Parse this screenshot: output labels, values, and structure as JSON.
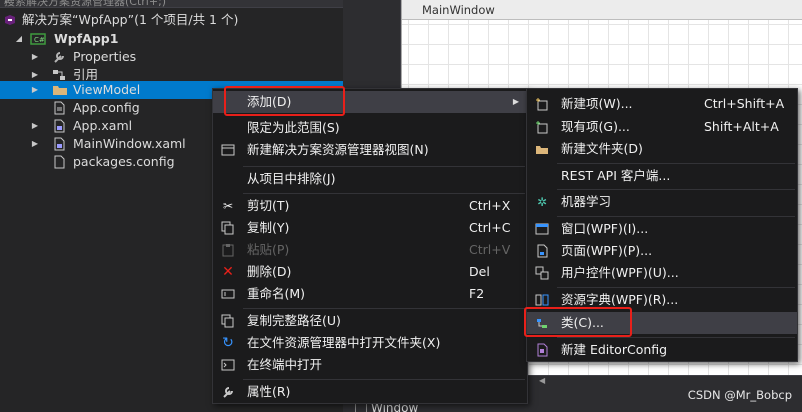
{
  "explorer": {
    "search_placeholder": "搜索解决方案资源管理器(Ctrl+;)",
    "items": [
      {
        "label": "解决方案“WpfApp”(1 个项目/共 1 个)"
      },
      {
        "label": "WpfApp1"
      },
      {
        "label": "Properties"
      },
      {
        "label": "引用"
      },
      {
        "label": "ViewModel"
      },
      {
        "label": "App.config"
      },
      {
        "label": "App.xaml"
      },
      {
        "label": "MainWindow.xaml"
      },
      {
        "label": "packages.config"
      }
    ]
  },
  "designer": {
    "window_title": "MainWindow",
    "xaml_tab": "Window",
    "watermark": "CSDN @Mr_Bobcp"
  },
  "context_menu": {
    "items": [
      {
        "label": "添加(D)",
        "shortcut": ""
      },
      {
        "label": "限定为此范围(S)",
        "shortcut": ""
      },
      {
        "label": "新建解决方案资源管理器视图(N)",
        "shortcut": ""
      },
      {
        "label": "从项目中排除(J)",
        "shortcut": ""
      },
      {
        "label": "剪切(T)",
        "shortcut": "Ctrl+X"
      },
      {
        "label": "复制(Y)",
        "shortcut": "Ctrl+C"
      },
      {
        "label": "粘贴(P)",
        "shortcut": "Ctrl+V"
      },
      {
        "label": "删除(D)",
        "shortcut": "Del"
      },
      {
        "label": "重命名(M)",
        "shortcut": "F2"
      },
      {
        "label": "复制完整路径(U)",
        "shortcut": ""
      },
      {
        "label": "在文件资源管理器中打开文件夹(X)",
        "shortcut": ""
      },
      {
        "label": "在终端中打开",
        "shortcut": ""
      },
      {
        "label": "属性(R)",
        "shortcut": ""
      }
    ]
  },
  "add_submenu": {
    "items": [
      {
        "label": "新建项(W)...",
        "shortcut": "Ctrl+Shift+A"
      },
      {
        "label": "现有项(G)...",
        "shortcut": "Shift+Alt+A"
      },
      {
        "label": "新建文件夹(D)",
        "shortcut": ""
      },
      {
        "label": "REST API 客户端...",
        "shortcut": ""
      },
      {
        "label": "机器学习",
        "shortcut": ""
      },
      {
        "label": "窗口(WPF)(I)...",
        "shortcut": ""
      },
      {
        "label": "页面(WPF)(P)...",
        "shortcut": ""
      },
      {
        "label": "用户控件(WPF)(U)...",
        "shortcut": ""
      },
      {
        "label": "资源字典(WPF)(R)...",
        "shortcut": ""
      },
      {
        "label": "类(C)...",
        "shortcut": ""
      },
      {
        "label": "新建 EditorConfig",
        "shortcut": ""
      }
    ]
  },
  "colors": {
    "highlight_box": "#e8201a",
    "selection": "#007acc"
  }
}
